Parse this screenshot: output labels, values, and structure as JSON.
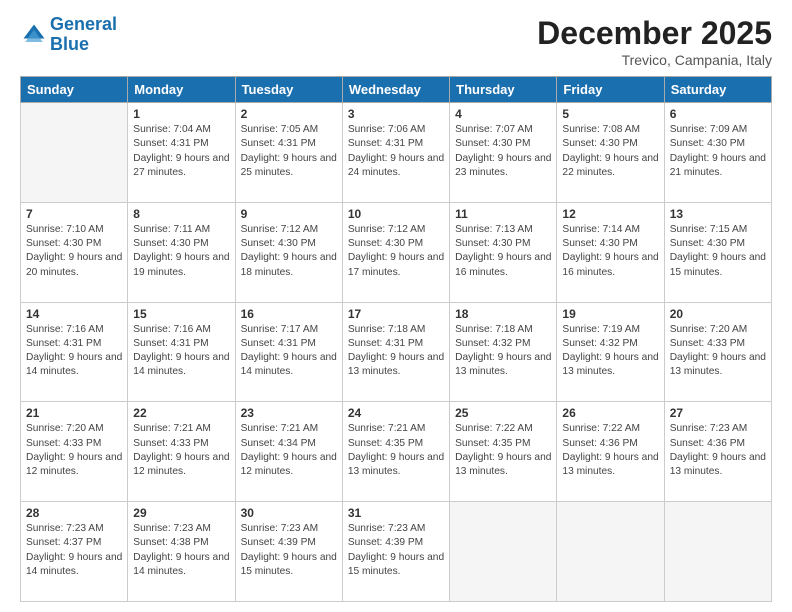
{
  "logo": {
    "line1": "General",
    "line2": "Blue"
  },
  "header": {
    "title": "December 2025",
    "subtitle": "Trevico, Campania, Italy"
  },
  "days_of_week": [
    "Sunday",
    "Monday",
    "Tuesday",
    "Wednesday",
    "Thursday",
    "Friday",
    "Saturday"
  ],
  "weeks": [
    [
      {
        "day": "",
        "sunrise": "",
        "sunset": "",
        "daylight": ""
      },
      {
        "day": "1",
        "sunrise": "Sunrise: 7:04 AM",
        "sunset": "Sunset: 4:31 PM",
        "daylight": "Daylight: 9 hours and 27 minutes."
      },
      {
        "day": "2",
        "sunrise": "Sunrise: 7:05 AM",
        "sunset": "Sunset: 4:31 PM",
        "daylight": "Daylight: 9 hours and 25 minutes."
      },
      {
        "day": "3",
        "sunrise": "Sunrise: 7:06 AM",
        "sunset": "Sunset: 4:31 PM",
        "daylight": "Daylight: 9 hours and 24 minutes."
      },
      {
        "day": "4",
        "sunrise": "Sunrise: 7:07 AM",
        "sunset": "Sunset: 4:30 PM",
        "daylight": "Daylight: 9 hours and 23 minutes."
      },
      {
        "day": "5",
        "sunrise": "Sunrise: 7:08 AM",
        "sunset": "Sunset: 4:30 PM",
        "daylight": "Daylight: 9 hours and 22 minutes."
      },
      {
        "day": "6",
        "sunrise": "Sunrise: 7:09 AM",
        "sunset": "Sunset: 4:30 PM",
        "daylight": "Daylight: 9 hours and 21 minutes."
      }
    ],
    [
      {
        "day": "7",
        "sunrise": "Sunrise: 7:10 AM",
        "sunset": "Sunset: 4:30 PM",
        "daylight": "Daylight: 9 hours and 20 minutes."
      },
      {
        "day": "8",
        "sunrise": "Sunrise: 7:11 AM",
        "sunset": "Sunset: 4:30 PM",
        "daylight": "Daylight: 9 hours and 19 minutes."
      },
      {
        "day": "9",
        "sunrise": "Sunrise: 7:12 AM",
        "sunset": "Sunset: 4:30 PM",
        "daylight": "Daylight: 9 hours and 18 minutes."
      },
      {
        "day": "10",
        "sunrise": "Sunrise: 7:12 AM",
        "sunset": "Sunset: 4:30 PM",
        "daylight": "Daylight: 9 hours and 17 minutes."
      },
      {
        "day": "11",
        "sunrise": "Sunrise: 7:13 AM",
        "sunset": "Sunset: 4:30 PM",
        "daylight": "Daylight: 9 hours and 16 minutes."
      },
      {
        "day": "12",
        "sunrise": "Sunrise: 7:14 AM",
        "sunset": "Sunset: 4:30 PM",
        "daylight": "Daylight: 9 hours and 16 minutes."
      },
      {
        "day": "13",
        "sunrise": "Sunrise: 7:15 AM",
        "sunset": "Sunset: 4:30 PM",
        "daylight": "Daylight: 9 hours and 15 minutes."
      }
    ],
    [
      {
        "day": "14",
        "sunrise": "Sunrise: 7:16 AM",
        "sunset": "Sunset: 4:31 PM",
        "daylight": "Daylight: 9 hours and 14 minutes."
      },
      {
        "day": "15",
        "sunrise": "Sunrise: 7:16 AM",
        "sunset": "Sunset: 4:31 PM",
        "daylight": "Daylight: 9 hours and 14 minutes."
      },
      {
        "day": "16",
        "sunrise": "Sunrise: 7:17 AM",
        "sunset": "Sunset: 4:31 PM",
        "daylight": "Daylight: 9 hours and 14 minutes."
      },
      {
        "day": "17",
        "sunrise": "Sunrise: 7:18 AM",
        "sunset": "Sunset: 4:31 PM",
        "daylight": "Daylight: 9 hours and 13 minutes."
      },
      {
        "day": "18",
        "sunrise": "Sunrise: 7:18 AM",
        "sunset": "Sunset: 4:32 PM",
        "daylight": "Daylight: 9 hours and 13 minutes."
      },
      {
        "day": "19",
        "sunrise": "Sunrise: 7:19 AM",
        "sunset": "Sunset: 4:32 PM",
        "daylight": "Daylight: 9 hours and 13 minutes."
      },
      {
        "day": "20",
        "sunrise": "Sunrise: 7:20 AM",
        "sunset": "Sunset: 4:33 PM",
        "daylight": "Daylight: 9 hours and 13 minutes."
      }
    ],
    [
      {
        "day": "21",
        "sunrise": "Sunrise: 7:20 AM",
        "sunset": "Sunset: 4:33 PM",
        "daylight": "Daylight: 9 hours and 12 minutes."
      },
      {
        "day": "22",
        "sunrise": "Sunrise: 7:21 AM",
        "sunset": "Sunset: 4:33 PM",
        "daylight": "Daylight: 9 hours and 12 minutes."
      },
      {
        "day": "23",
        "sunrise": "Sunrise: 7:21 AM",
        "sunset": "Sunset: 4:34 PM",
        "daylight": "Daylight: 9 hours and 12 minutes."
      },
      {
        "day": "24",
        "sunrise": "Sunrise: 7:21 AM",
        "sunset": "Sunset: 4:35 PM",
        "daylight": "Daylight: 9 hours and 13 minutes."
      },
      {
        "day": "25",
        "sunrise": "Sunrise: 7:22 AM",
        "sunset": "Sunset: 4:35 PM",
        "daylight": "Daylight: 9 hours and 13 minutes."
      },
      {
        "day": "26",
        "sunrise": "Sunrise: 7:22 AM",
        "sunset": "Sunset: 4:36 PM",
        "daylight": "Daylight: 9 hours and 13 minutes."
      },
      {
        "day": "27",
        "sunrise": "Sunrise: 7:23 AM",
        "sunset": "Sunset: 4:36 PM",
        "daylight": "Daylight: 9 hours and 13 minutes."
      }
    ],
    [
      {
        "day": "28",
        "sunrise": "Sunrise: 7:23 AM",
        "sunset": "Sunset: 4:37 PM",
        "daylight": "Daylight: 9 hours and 14 minutes."
      },
      {
        "day": "29",
        "sunrise": "Sunrise: 7:23 AM",
        "sunset": "Sunset: 4:38 PM",
        "daylight": "Daylight: 9 hours and 14 minutes."
      },
      {
        "day": "30",
        "sunrise": "Sunrise: 7:23 AM",
        "sunset": "Sunset: 4:39 PM",
        "daylight": "Daylight: 9 hours and 15 minutes."
      },
      {
        "day": "31",
        "sunrise": "Sunrise: 7:23 AM",
        "sunset": "Sunset: 4:39 PM",
        "daylight": "Daylight: 9 hours and 15 minutes."
      },
      {
        "day": "",
        "sunrise": "",
        "sunset": "",
        "daylight": ""
      },
      {
        "day": "",
        "sunrise": "",
        "sunset": "",
        "daylight": ""
      },
      {
        "day": "",
        "sunrise": "",
        "sunset": "",
        "daylight": ""
      }
    ]
  ]
}
